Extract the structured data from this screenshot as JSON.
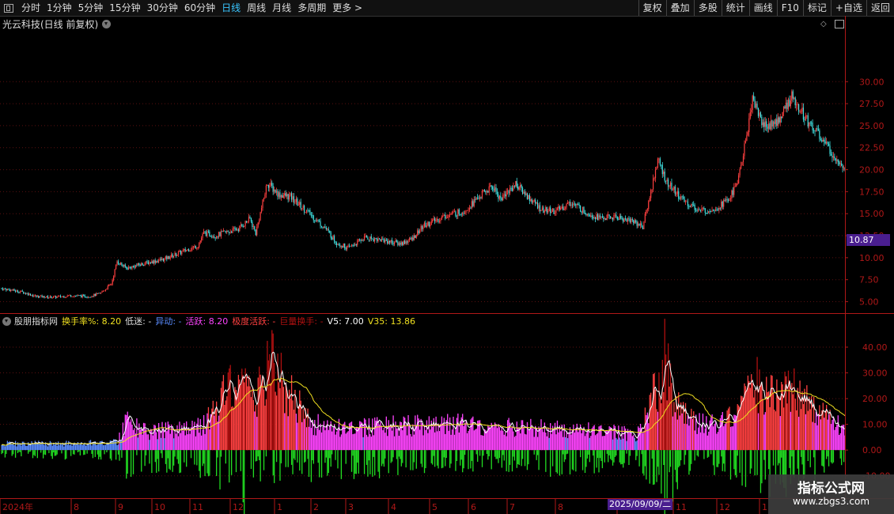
{
  "toolbar": {
    "periods": [
      "分时",
      "1分钟",
      "5分钟",
      "15分钟",
      "30分钟",
      "60分钟",
      "日线",
      "周线",
      "月线",
      "多周期",
      "更多 >"
    ],
    "active_period": "日线",
    "right_buttons": [
      "复权",
      "叠加",
      "多股",
      "统计",
      "画线",
      "F10",
      "标记",
      "+自选",
      "返回"
    ]
  },
  "main_chart": {
    "title": "光云科技(日线 前复权)",
    "current_price": "10.87",
    "y_axis_ticks": [
      "30.00",
      "27.50",
      "25.00",
      "22.50",
      "20.00",
      "17.50",
      "15.00",
      "12.50",
      "10.00",
      "7.50",
      "5.00"
    ],
    "y_axis_values": [
      30,
      27.5,
      25,
      22.5,
      20,
      17.5,
      15,
      12.5,
      10,
      7.5,
      5
    ],
    "y_range": [
      3.7,
      37.3
    ]
  },
  "sub_chart": {
    "indicator_name": "股朋指标网",
    "legend": [
      {
        "label": "换手率%: 8.20",
        "color": "#f0e020"
      },
      {
        "label": "低迷: -",
        "color": "#dddddd"
      },
      {
        "label": "异动: -",
        "color": "#5a8cff"
      },
      {
        "label": "活跃: 8.20",
        "color": "#ff44ff"
      },
      {
        "label": "极度活跃: -",
        "color": "#ff4040"
      },
      {
        "label": "巨量换手: -",
        "color": "#b01010"
      },
      {
        "label": "V5: 7.00",
        "color": "#ffffff"
      },
      {
        "label": "V35: 13.86",
        "color": "#f0e020"
      }
    ],
    "y_axis_ticks": [
      "40.00",
      "30.00",
      "20.00",
      "10.00",
      "0.00",
      "-10.00"
    ],
    "y_axis_values": [
      40,
      30,
      20,
      10,
      0,
      -10
    ],
    "y_range": [
      -18.7,
      52.6
    ]
  },
  "x_axis": {
    "labels": [
      "2024年",
      "8",
      "9",
      "10",
      "11",
      "12",
      "1",
      "2",
      "3",
      "4",
      "5",
      "6",
      "7",
      "8",
      "9",
      "11",
      "12",
      "1"
    ],
    "highlight_date": "2025/09/09/二"
  },
  "watermark": {
    "title": "指标公式网",
    "url": "www.zbgs3.com"
  },
  "colors": {
    "up": "#ff4040",
    "down": "#40e0e0",
    "grid": "#5a1010",
    "axis": "#b01818",
    "active": "#39c5ff",
    "purple": "#4a1e8f"
  },
  "icons": [
    "window-icon",
    "dropdown-circle-icon",
    "diamond-icon",
    "panel-toggle-icon"
  ],
  "chart_data": {
    "type": "candlestick",
    "price_path": [
      [
        0,
        6.5
      ],
      [
        18,
        6.1
      ],
      [
        30,
        5.6
      ],
      [
        45,
        5.5
      ],
      [
        60,
        5.7
      ],
      [
        75,
        5.6
      ],
      [
        85,
        5.9
      ],
      [
        95,
        7.0
      ],
      [
        100,
        9.6
      ],
      [
        108,
        8.8
      ],
      [
        125,
        9.4
      ],
      [
        140,
        9.8
      ],
      [
        155,
        10.6
      ],
      [
        170,
        11.4
      ],
      [
        175,
        12.8
      ],
      [
        185,
        12.5
      ],
      [
        205,
        13.3
      ],
      [
        215,
        14.4
      ],
      [
        220,
        12.8
      ],
      [
        230,
        18.5
      ],
      [
        240,
        17.2
      ],
      [
        250,
        16.9
      ],
      [
        265,
        15.2
      ],
      [
        280,
        13.4
      ],
      [
        290,
        11.7
      ],
      [
        300,
        11.1
      ],
      [
        315,
        12.3
      ],
      [
        330,
        12.0
      ],
      [
        345,
        11.6
      ],
      [
        355,
        12.1
      ],
      [
        365,
        13.6
      ],
      [
        375,
        14.2
      ],
      [
        385,
        14.8
      ],
      [
        400,
        15.3
      ],
      [
        415,
        17.1
      ],
      [
        425,
        18.1
      ],
      [
        432,
        16.7
      ],
      [
        445,
        18.4
      ],
      [
        455,
        17.0
      ],
      [
        468,
        15.4
      ],
      [
        480,
        15.3
      ],
      [
        493,
        16.3
      ],
      [
        505,
        15.2
      ],
      [
        518,
        14.5
      ],
      [
        532,
        14.6
      ],
      [
        548,
        14.1
      ],
      [
        555,
        13.5
      ],
      [
        562,
        17.5
      ],
      [
        568,
        21.2
      ],
      [
        576,
        18.5
      ],
      [
        590,
        16.5
      ],
      [
        605,
        15.3
      ],
      [
        618,
        15.6
      ],
      [
        630,
        16.7
      ],
      [
        638,
        19.0
      ],
      [
        645,
        24.0
      ],
      [
        650,
        28.0
      ],
      [
        660,
        25.0
      ],
      [
        672,
        25.5
      ],
      [
        685,
        28.5
      ],
      [
        695,
        26.0
      ],
      [
        705,
        24.5
      ],
      [
        715,
        22.5
      ],
      [
        725,
        21.0
      ],
      [
        730,
        20.4
      ]
    ],
    "turnover_path": [
      [
        0,
        2.5
      ],
      [
        60,
        2.5
      ],
      [
        100,
        3.0
      ],
      [
        108,
        11.0
      ],
      [
        125,
        7.0
      ],
      [
        145,
        8.0
      ],
      [
        170,
        9.0
      ],
      [
        182,
        13.0
      ],
      [
        200,
        30.0
      ],
      [
        212,
        28.0
      ],
      [
        222,
        22.0
      ],
      [
        232,
        37.0
      ],
      [
        242,
        27.0
      ],
      [
        255,
        18.0
      ],
      [
        268,
        10.0
      ],
      [
        300,
        8.5
      ],
      [
        350,
        9.5
      ],
      [
        400,
        10.0
      ],
      [
        450,
        8.5
      ],
      [
        500,
        8.0
      ],
      [
        550,
        6.0
      ],
      [
        565,
        22.0
      ],
      [
        575,
        37.0
      ],
      [
        582,
        18.0
      ],
      [
        595,
        12.0
      ],
      [
        620,
        9.0
      ],
      [
        640,
        18.0
      ],
      [
        650,
        30.0
      ],
      [
        660,
        22.0
      ],
      [
        670,
        20.0
      ],
      [
        680,
        28.0
      ],
      [
        695,
        18.0
      ],
      [
        710,
        15.0
      ],
      [
        725,
        9.0
      ],
      [
        730,
        7.0
      ]
    ],
    "volume_down_path": [
      [
        0,
        -2
      ],
      [
        100,
        -3
      ],
      [
        108,
        -9
      ],
      [
        140,
        -6
      ],
      [
        170,
        -7
      ],
      [
        200,
        -13
      ],
      [
        212,
        -25
      ],
      [
        222,
        -9
      ],
      [
        232,
        -11
      ],
      [
        245,
        -10
      ],
      [
        280,
        -8
      ],
      [
        350,
        -7
      ],
      [
        420,
        -6
      ],
      [
        480,
        -7
      ],
      [
        550,
        -5
      ],
      [
        568,
        -12
      ],
      [
        575,
        -22
      ],
      [
        582,
        -12
      ],
      [
        600,
        -7
      ],
      [
        650,
        -10
      ],
      [
        660,
        -15
      ],
      [
        680,
        -12
      ],
      [
        700,
        -10
      ],
      [
        720,
        -6
      ],
      [
        730,
        -4
      ]
    ]
  }
}
